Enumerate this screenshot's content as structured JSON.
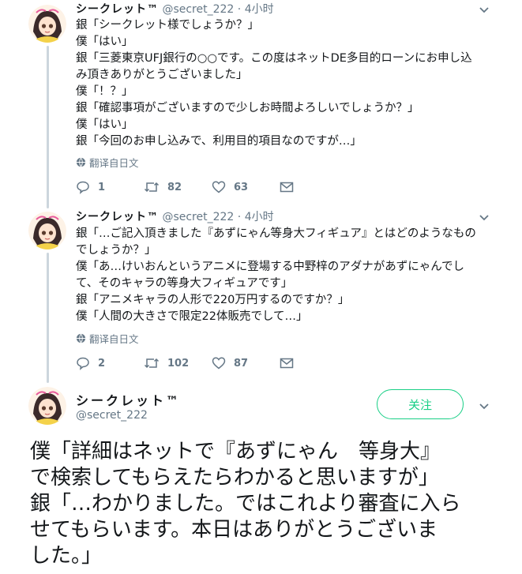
{
  "tweets": [
    {
      "name": "シークレット™",
      "handle": "@secret_222",
      "time": "· 4小时",
      "lines": [
        "銀「シークレット様でしょうか？」",
        "僕「はい」",
        "銀「三菱東京UFJ銀行の○○です。この度はネットDE多目的ローンにお申し込",
        "み頂きありがとうございました」",
        "僕「！？」",
        "銀「確認事項がございますので少しお時間よろしいでしょうか？」",
        "僕「はい」",
        "銀「今回のお申し込みで、利用目的項目なのですが…」"
      ],
      "translate": "翻译自日文",
      "replies": "1",
      "retweets": "82",
      "likes": "63"
    },
    {
      "name": "シークレット™",
      "handle": "@secret_222",
      "time": "· 4小时",
      "lines": [
        "銀「…ご記入頂きました『あずにゃん等身大フィギュア』とはどのようなもの",
        "でしょうか？」",
        "僕「あ…けいおんというアニメに登場する中野梓のアダナがあずにゃんでし",
        "て、そのキャラの等身大フィギュアです」",
        "銀「アニメキャラの人形で220万円するのですか？」",
        "僕「人間の大きさで限定22体販売でして…」"
      ],
      "translate": "翻译自日文",
      "replies": "2",
      "retweets": "102",
      "likes": "87"
    }
  ],
  "main_tweet": {
    "name": "シークレット™",
    "handle": "@secret_222",
    "follow_label": "关注",
    "lines": [
      "僕「詳細はネットで『あずにゃん　等身大』",
      "で検索してもらえたらわかると思いますが」",
      "銀「…わかりました。ではこれより審査に入ら",
      "せてもらいます。本日はありがとうございま",
      "した。」"
    ]
  },
  "icons": {
    "reply": "reply-icon",
    "retweet": "retweet-icon",
    "like": "heart-icon",
    "dm": "envelope-icon",
    "translate": "globe-icon",
    "more": "chevron-down-icon"
  },
  "colors": {
    "follow_green": "#19cf86",
    "muted": "#657786",
    "thread_line": "#ccd6dd"
  }
}
